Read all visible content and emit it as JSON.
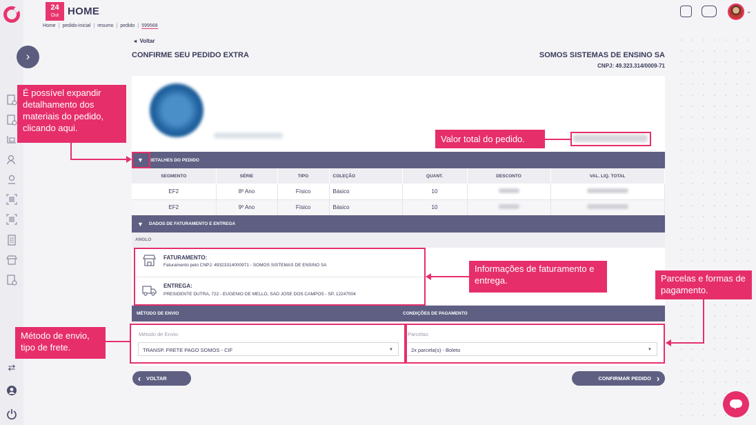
{
  "header": {
    "date_day": "24",
    "date_month": "Out",
    "title": "HOME",
    "breadcrumb": [
      "Home",
      "pedido-inicial",
      "resumo",
      "pedido",
      "599568"
    ]
  },
  "nav": {
    "back_top": "Voltar",
    "page_title": "CONFIRME SEU PEDIDO EXTRA",
    "company": "SOMOS SISTEMAS DE ENSINO SA",
    "cnpj": "CNPJ: 49.323.314/0009-71"
  },
  "order_details": {
    "bar_label": "DETALHES DO PEDIDO",
    "columns": [
      "SEGMENTO",
      "SÉRIE",
      "TIPO",
      "COLEÇÃO",
      "QUANT.",
      "DESCONTO",
      "VAL. LIQ. TOTAL"
    ],
    "rows": [
      {
        "segmento": "EF2",
        "serie": "8º Ano",
        "tipo": "Físico",
        "colecao": "Básico",
        "quant": "10"
      },
      {
        "segmento": "EF2",
        "serie": "9º Ano",
        "tipo": "Físico",
        "colecao": "Básico",
        "quant": "10"
      }
    ]
  },
  "billing": {
    "bar_label": "DADOS DE FATURAMENTO E ENTREGA",
    "brand": "ANGLO",
    "faturamento_title": "FATURAMENTO:",
    "faturamento_text": "Faturamento pelo CNPJ: 49323314000971 - SOMOS SISTEMAS DE ENSINO SA",
    "entrega_title": "ENTREGA:",
    "entrega_text": "PRESIDENTE DUTRA, 722 - EUGENIO DE MELLO, SAO JOSE DOS CAMPOS - SP, 12247004"
  },
  "shipping": {
    "method_header": "MÉTODO DE ENVIO",
    "payment_header": "CONDIÇÕES DE PAGAMENTO",
    "method_label": "Método de Envio:",
    "method_value": "TRANSP. FRETE PAGO SOMOS - CIF",
    "payment_label": "Parcelas:",
    "payment_value": "2x parcela(s) - Boleto"
  },
  "actions": {
    "back_label": "VOLTAR",
    "confirm_label": "CONFIRMAR PEDIDO"
  },
  "annotations": {
    "expand": "É possível expandir detalhamento dos materiais do pedido, clicando aqui.",
    "total": "Valor total do pedido.",
    "billing": "Informações de faturamento e entrega.",
    "payment": "Parcelas e formas de pagamento.",
    "shipping": "Método de envio, tipo de frete."
  },
  "colors": {
    "accent": "#e62e6b",
    "bar": "#5e5f82"
  }
}
